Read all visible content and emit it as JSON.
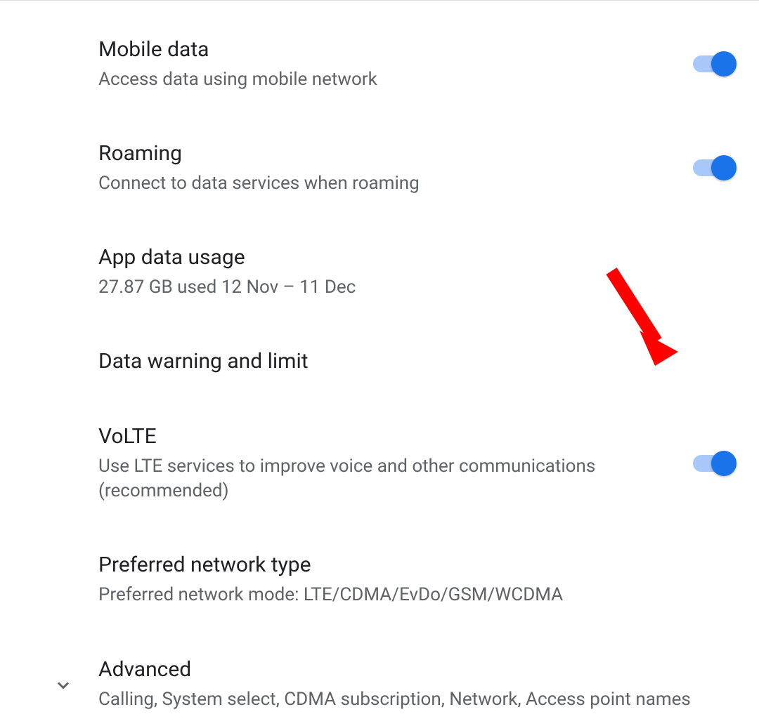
{
  "settings": [
    {
      "title": "Mobile data",
      "subtitle": "Access data using mobile network",
      "hasToggle": true,
      "toggleOn": true
    },
    {
      "title": "Roaming",
      "subtitle": "Connect to data services when roaming",
      "hasToggle": true,
      "toggleOn": true
    },
    {
      "title": "App data usage",
      "subtitle": "27.87 GB used 12 Nov – 11 Dec",
      "hasToggle": false
    },
    {
      "title": "Data warning and limit",
      "subtitle": "",
      "hasToggle": false
    },
    {
      "title": "VoLTE",
      "subtitle": "Use LTE services to improve voice and other communications (recommended)",
      "hasToggle": true,
      "toggleOn": true
    },
    {
      "title": "Preferred network type",
      "subtitle": "Preferred network mode: LTE/CDMA/EvDo/GSM/WCDMA",
      "hasToggle": false
    }
  ],
  "advanced": {
    "title": "Advanced",
    "subtitle": "Calling, System select, CDMA subscription, Network, Access point names"
  }
}
